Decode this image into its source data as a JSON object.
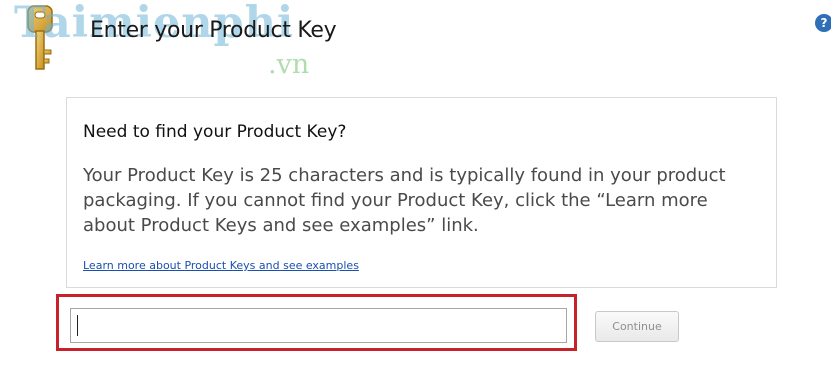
{
  "header": {
    "title": "Enter your Product Key",
    "help_icon": "question-mark-icon",
    "help_glyph": "?"
  },
  "watermark": {
    "main": "Taimienphi",
    "sub": ".vn"
  },
  "info_panel": {
    "heading": "Need to find your Product Key?",
    "body": "Your Product Key is 25 characters and is typically found in your product packaging. If you cannot find your Product Key, click the “Learn more about Product Keys and see examples” link.",
    "link_label": "Learn more about Product Keys and see examples"
  },
  "key_entry": {
    "value": "",
    "placeholder": "",
    "continue_label": "Continue",
    "continue_enabled": false
  },
  "colors": {
    "highlight_border": "#c9212b",
    "link": "#1a4fb0",
    "help_icon_bg": "#2f6fb8"
  }
}
